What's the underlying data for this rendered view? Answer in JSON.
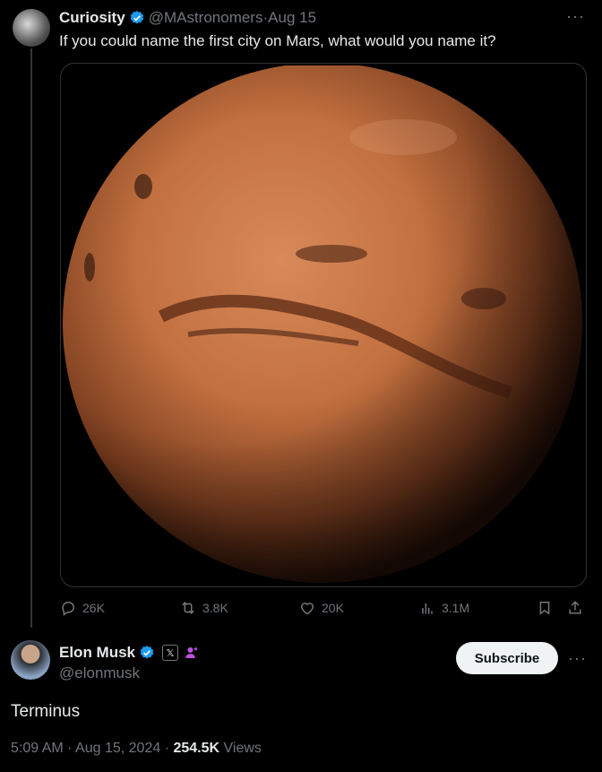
{
  "original_tweet": {
    "author_name": "Curiosity",
    "handle": "@MAstronomers",
    "date": "Aug 15",
    "text": "If you could name the first city on Mars, what would you name it?",
    "image_icon": "mars-image",
    "actions": {
      "replies": "26K",
      "reposts": "3.8K",
      "likes": "20K",
      "views": "3.1M"
    }
  },
  "reply": {
    "author_name": "Elon Musk",
    "handle": "@elonmusk",
    "badge_letter": "𝕏",
    "subscribe_label": "Subscribe",
    "text": "Terminus",
    "time": "5:09 AM",
    "date": "Aug 15, 2024",
    "views_count": "254.5K",
    "views_label": "Views"
  },
  "more_label": "···",
  "separator": " · ",
  "colors": {
    "background": "#000000",
    "verified": "#1d9bf0",
    "muted": "#71767b",
    "affiliate": "#c050e0"
  }
}
